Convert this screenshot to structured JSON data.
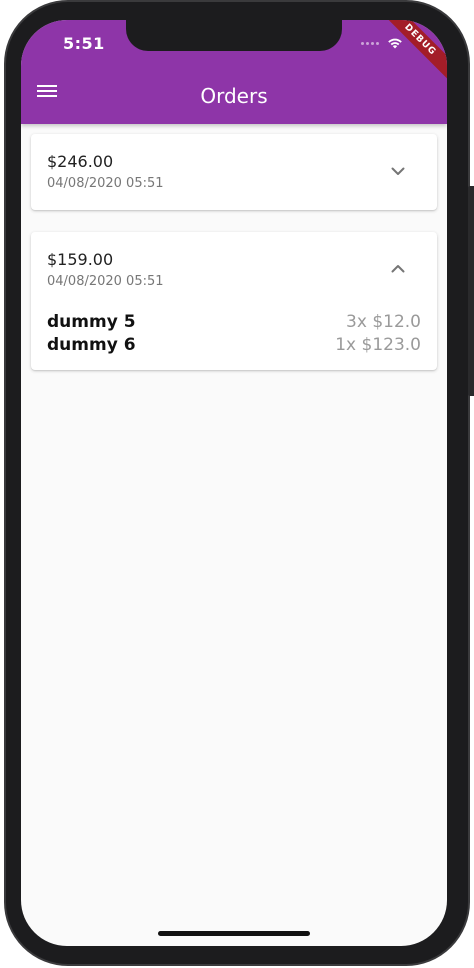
{
  "status_bar": {
    "time": "5:51",
    "debug_banner": "DEBUG"
  },
  "app_bar": {
    "title": "Orders",
    "menu_icon": "hamburger-menu-icon"
  },
  "orders": [
    {
      "amount": "$246.00",
      "datetime": "04/08/2020 05:51",
      "expanded": false,
      "toggle_icon": "chevron-down-icon",
      "items": []
    },
    {
      "amount": "$159.00",
      "datetime": "04/08/2020 05:51",
      "expanded": true,
      "toggle_icon": "chevron-up-icon",
      "items": [
        {
          "name": "dummy 5",
          "quantity_price": "3x $12.0"
        },
        {
          "name": "dummy 6",
          "quantity_price": "1x $123.0"
        }
      ]
    }
  ],
  "colors": {
    "primary": "#8e35a8",
    "background": "#fafafa",
    "debug_ribbon": "#a31d28"
  }
}
